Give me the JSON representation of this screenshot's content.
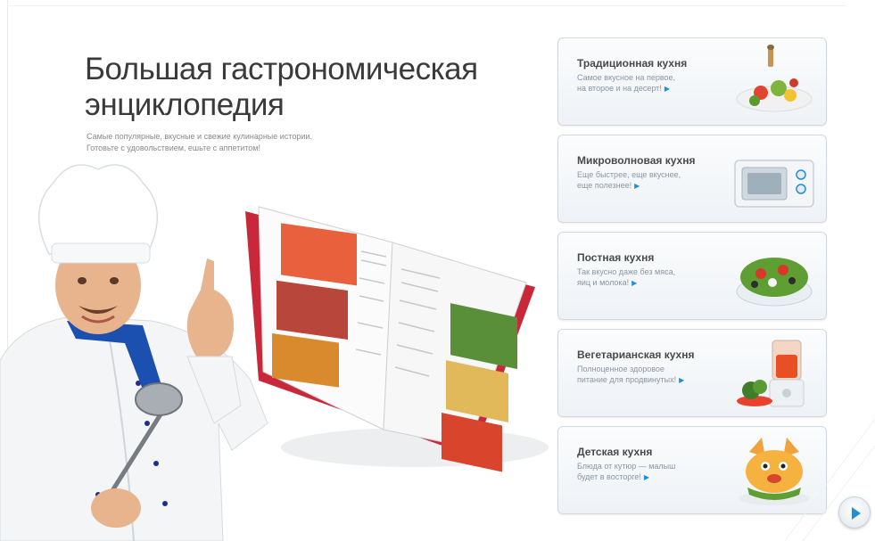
{
  "header": {
    "title_line1": "Большая гастрономическая",
    "title_line2": "энциклопедия",
    "subtitle_line1": "Самые популярные, вкусные и свежие кулинарные истории.",
    "subtitle_line2": "Готовьте с удовольствием, ешьте с аппетитом!"
  },
  "categories": [
    {
      "title": "Традиционная кухня",
      "desc_line1": "Самое вкусное на первое,",
      "desc_line2": "на второе и на десерт!",
      "icon": "salad-plate-icon"
    },
    {
      "title": "Микроволновая кухня",
      "desc_line1": "Еще быстрее, еще вкуснее,",
      "desc_line2": "еще полезнее!",
      "icon": "microwave-icon"
    },
    {
      "title": "Постная кухня",
      "desc_line1": "Так вкусно даже без мяса,",
      "desc_line2": "яиц и молока!",
      "icon": "salad-bowl-icon"
    },
    {
      "title": "Вегетарианская кухня",
      "desc_line1": "Полноценное здоровое",
      "desc_line2": "питание для продвинутых!",
      "icon": "blender-icon"
    },
    {
      "title": "Детская кухня",
      "desc_line1": "Блюда от кутюр — малыш",
      "desc_line2": "будет в восторге!",
      "icon": "kids-dish-icon"
    }
  ],
  "arrow_glyph": "▶",
  "accent_color": "#1f8fd6"
}
